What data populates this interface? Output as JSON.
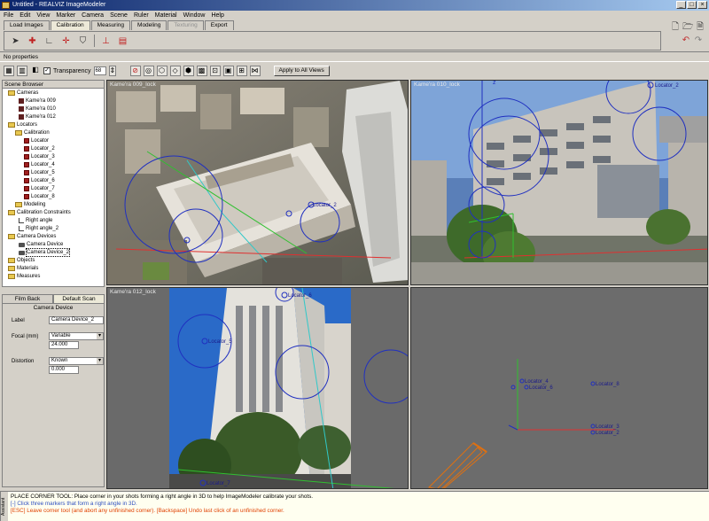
{
  "window": {
    "title": "Untitled - REALVIZ ImageModeler"
  },
  "menu": [
    "File",
    "Edit",
    "View",
    "Marker",
    "Camera",
    "Scene",
    "Ruler",
    "Material",
    "Window",
    "Help"
  ],
  "tabs": [
    {
      "label": "Load Images",
      "state": "normal"
    },
    {
      "label": "Calibration",
      "state": "active"
    },
    {
      "label": "Measuring",
      "state": "normal"
    },
    {
      "label": "Modeling",
      "state": "normal"
    },
    {
      "label": "Texturing",
      "state": "disabled"
    },
    {
      "label": "Export",
      "state": "normal"
    }
  ],
  "properties": {
    "text": "No properties"
  },
  "viewbar": {
    "transparency_label": "Transparency",
    "transparency_value": "68",
    "apply_label": "Apply to All Views"
  },
  "scene_browser": {
    "title": "Scene Browser",
    "items": [
      {
        "label": "Cameras",
        "type": "folder"
      },
      {
        "label": "Kame'ra 009",
        "type": "camera"
      },
      {
        "label": "Kame'ra 010",
        "type": "camera"
      },
      {
        "label": "Kame'ra 012",
        "type": "camera"
      },
      {
        "label": "Locators",
        "type": "folder"
      },
      {
        "label": "Calibration",
        "type": "folder"
      },
      {
        "label": "Locator",
        "type": "locator"
      },
      {
        "label": "Locator_2",
        "type": "locator"
      },
      {
        "label": "Locator_3",
        "type": "locator"
      },
      {
        "label": "Locator_4",
        "type": "locator"
      },
      {
        "label": "Locator_5",
        "type": "locator"
      },
      {
        "label": "Locator_6",
        "type": "locator"
      },
      {
        "label": "Locator_7",
        "type": "locator"
      },
      {
        "label": "Locator_8",
        "type": "locator"
      },
      {
        "label": "Modeling",
        "type": "folder"
      },
      {
        "label": "Calibration Constraints",
        "type": "folder"
      },
      {
        "label": "Right angle",
        "type": "angle"
      },
      {
        "label": "Right angle_2",
        "type": "angle"
      },
      {
        "label": "Camera Devices",
        "type": "folder"
      },
      {
        "label": "Camera Device",
        "type": "device"
      },
      {
        "label": "Camera Device_2",
        "type": "device",
        "selected": true
      },
      {
        "label": "Objects",
        "type": "folder"
      },
      {
        "label": "Materials",
        "type": "folder"
      },
      {
        "label": "Measures",
        "type": "folder"
      }
    ]
  },
  "device_panel": {
    "tabs": [
      "Film Back",
      "Default Scan"
    ],
    "title": "Camera Device",
    "label_caption": "Label",
    "label_value": "Camera Device_2",
    "focal_caption": "Focal (mm)",
    "focal_mode": "Variable",
    "focal_value": "24.000",
    "distortion_caption": "Distortion",
    "distortion_mode": "Known",
    "distortion_value": "0.000"
  },
  "viewports": {
    "top_left": {
      "title": "Kame'ra 009_lock"
    },
    "top_right": {
      "title": "Kame'ra 010_lock"
    },
    "bottom_left": {
      "title": "Kame'ra 012_lock"
    },
    "bottom_right": {
      "title": ""
    }
  },
  "locator_labels": {
    "tl": [
      "Locator_2"
    ],
    "tr": [
      "Locator_2"
    ],
    "bl": [
      "Locator_5",
      "Locator_6",
      "Locator_7"
    ],
    "br": [
      "Locator_4",
      "Locator_6",
      "Locator_8",
      "Locator_3",
      "Locator_2"
    ]
  },
  "status": {
    "side": "Assistant",
    "line1": "PLACE CORNER TOOL: Place corner in your shots forming a right angle in 3D to help ImageModeler calibrate your shots.",
    "line2": "[-] Click three markers that form a right angle in 3D.",
    "line3": "[ESC] Leave corner tool (and abort any unfinished corner). [Backspace] Undo last click of an unfinished corner."
  },
  "colors": {
    "title_bar": "#0a246a",
    "locator_circle": "#2030c0",
    "axis_y": "#30c030",
    "axis_x": "#e03030",
    "wire": "#e07010"
  }
}
